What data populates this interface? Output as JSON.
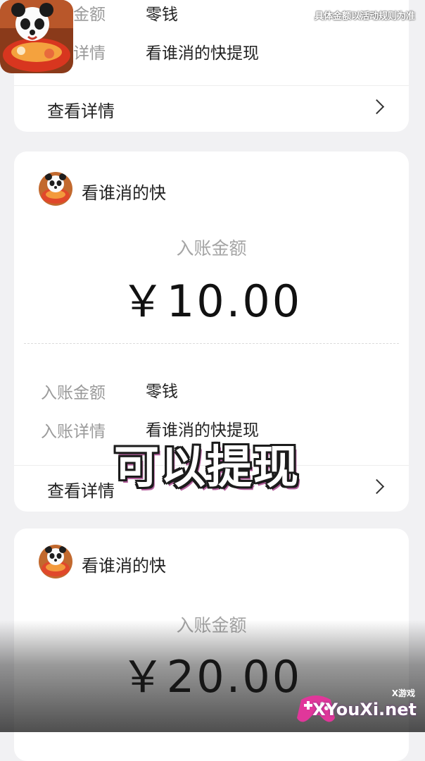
{
  "overlay": {
    "top_note": "具体金额以活动规则为准",
    "caption": "可以提现",
    "watermark_sub": "X游戏",
    "watermark_main": "XYouXi.net"
  },
  "cards": [
    {
      "rows": [
        {
          "label": "入账金额",
          "value": "零钱"
        },
        {
          "label": "入账详情",
          "value": "看谁消的快提现"
        }
      ],
      "detail_label": "查看详情"
    },
    {
      "app_name": "看谁消的快",
      "amount_label": "入账金额",
      "amount": "￥10.00",
      "rows": [
        {
          "label": "入账金额",
          "value": "零钱"
        },
        {
          "label": "入账详情",
          "value": "看谁消的快提现"
        }
      ],
      "detail_label": "查看详情"
    },
    {
      "app_name": "看谁消的快",
      "amount_label": "入账金额",
      "amount": "￥20.00"
    }
  ],
  "icons": {
    "app_icon": "panda-hotpot-icon",
    "chevron": "chevron-right-icon",
    "watermark_logo": "gamepad-icon"
  }
}
